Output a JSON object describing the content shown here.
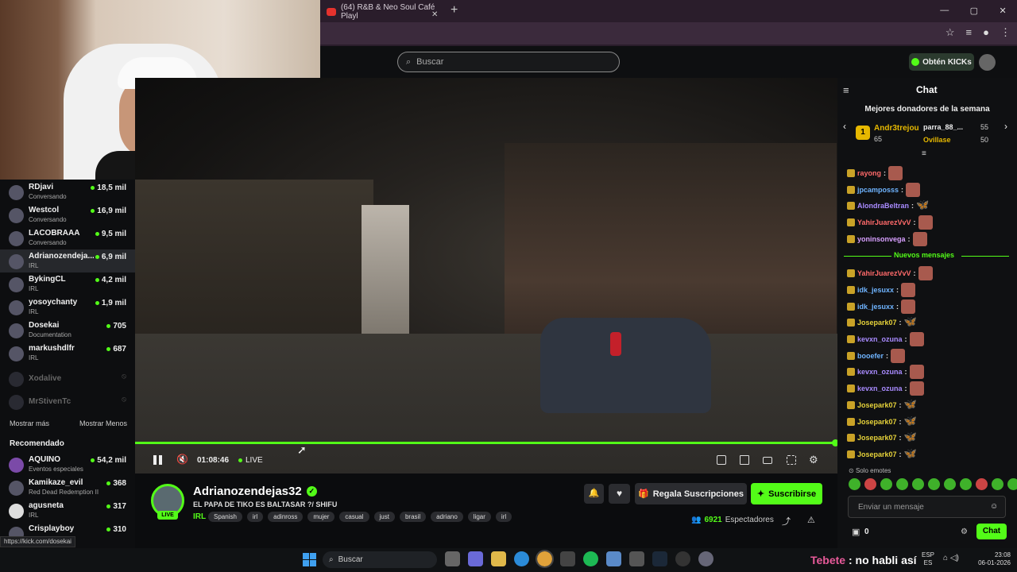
{
  "browser": {
    "tab_title": "(64) R&B & Neo Soul Café Playl",
    "tab_close": "✕",
    "new_tab": "+",
    "window_controls": [
      "—",
      "▢",
      "✕"
    ]
  },
  "topbar": {
    "search_placeholder": "Buscar",
    "kicks_label": "Obtén KICKs"
  },
  "sidebar": {
    "channels": [
      {
        "name": "RDjavi",
        "category": "Conversando",
        "viewers": "18,5 mil"
      },
      {
        "name": "Westcol",
        "category": "Conversando",
        "viewers": "16,9 mil"
      },
      {
        "name": "LACOBRAAA",
        "category": "Conversando",
        "viewers": "9,5 mil"
      },
      {
        "name": "Adrianozendeja...",
        "category": "IRL",
        "viewers": "6,9 mil"
      },
      {
        "name": "BykingCL",
        "category": "IRL",
        "viewers": "4,2 mil"
      },
      {
        "name": "yosoychanty",
        "category": "IRL",
        "viewers": "1,9 mil"
      },
      {
        "name": "Dosekai",
        "category": "Documentation",
        "viewers": "705"
      },
      {
        "name": "markushdlfr",
        "category": "IRL",
        "viewers": "687"
      },
      {
        "name": "Xodalive",
        "category": "",
        "viewers": ""
      },
      {
        "name": "MrStivenTc",
        "category": "",
        "viewers": ""
      }
    ],
    "show_more": "Mostrar más",
    "show_less": "Mostrar Menos",
    "recommended_title": "Recomendado",
    "recommended": [
      {
        "name": "AQUINO",
        "category": "Eventos especiales",
        "viewers": "54,2 mil"
      },
      {
        "name": "Kamikaze_evil",
        "category": "Red Dead Redemption II",
        "viewers": "368"
      },
      {
        "name": "agusneta",
        "category": "IRL",
        "viewers": "317"
      },
      {
        "name": "Crisplayboy",
        "category": "",
        "viewers": "310"
      }
    ],
    "status_url": "https://kick.com/dosekai"
  },
  "player": {
    "time": "01:08:46",
    "live_label": "LIVE",
    "progress": 0.995
  },
  "stream": {
    "streamer": "Adrianozendejas32",
    "live_badge": "LIVE",
    "title": "EL PAPA DE TIKO ES BALTASAR ?/ SHIFU",
    "category": "IRL",
    "tags": [
      "Spanish",
      "irl",
      "adinross",
      "mujer",
      "casual",
      "just",
      "brasil",
      "adriano",
      "ligar",
      "irl"
    ],
    "gift_label": "Regala Suscripciones",
    "subscribe_label": "Suscribirse",
    "viewers_count": "6921",
    "viewers_label": "Espectadores"
  },
  "chat": {
    "title": "Chat",
    "donors_title": "Mejores donadores de la semana",
    "donors": [
      {
        "name": "Andr3trejou",
        "amount": "65",
        "rank": "1"
      },
      {
        "name": "parra_88_...",
        "amount": "55"
      },
      {
        "name": "Ovillase",
        "amount": "50"
      }
    ],
    "new_messages_label": "Nuevos mensajes",
    "messages": [
      {
        "user": "rayong",
        "color": "#ff6a6a",
        "emote": "red"
      },
      {
        "user": "jpcamposss",
        "color": "#6fb4ff",
        "emote": "red"
      },
      {
        "user": "AlondraBeltran",
        "color": "#a98bff",
        "emote": "blue"
      },
      {
        "user": "YahirJuarezVvV",
        "color": "#ff6a6a",
        "emote": "red"
      },
      {
        "user": "yoninsonvega",
        "color": "#d8a0ff",
        "emote": "red"
      },
      {
        "user": "YahirJuarezVvV",
        "color": "#ff6a6a",
        "emote": "red"
      },
      {
        "user": "idk_jesuxx",
        "color": "#6fb4ff",
        "emote": "red"
      },
      {
        "user": "idk_jesuxx",
        "color": "#6fb4ff",
        "emote": "red"
      },
      {
        "user": "Josepark07",
        "color": "#e6d23a",
        "emote": "blue"
      },
      {
        "user": "kevxn_ozuna",
        "color": "#a98bff",
        "emote": "red"
      },
      {
        "user": "booefer",
        "color": "#6fb4ff",
        "emote": "red"
      },
      {
        "user": "kevxn_ozuna",
        "color": "#a98bff",
        "emote": "red"
      },
      {
        "user": "kevxn_ozuna",
        "color": "#a98bff",
        "emote": "red"
      },
      {
        "user": "Josepark07",
        "color": "#e6d23a",
        "emote": "blue"
      },
      {
        "user": "Josepark07",
        "color": "#e6d23a",
        "emote": "blue"
      },
      {
        "user": "Josepark07",
        "color": "#e6d23a",
        "emote": "blue"
      },
      {
        "user": "Josepark07",
        "color": "#e6d23a",
        "emote": "blue"
      }
    ],
    "emotes_only": "Solo emotes",
    "input_placeholder": "Enviar un mensaje",
    "kicks_count": "0",
    "send_label": "Chat"
  },
  "taskbar": {
    "search_placeholder": "Buscar",
    "overlay_user": "Tebete",
    "overlay_text": ": no habli así",
    "lang_1": "ESP",
    "lang_2": "ES",
    "time": "23:08",
    "date": "06-01-2026"
  },
  "colors": {
    "accent": "#53fc18",
    "gold": "#e6b800"
  }
}
